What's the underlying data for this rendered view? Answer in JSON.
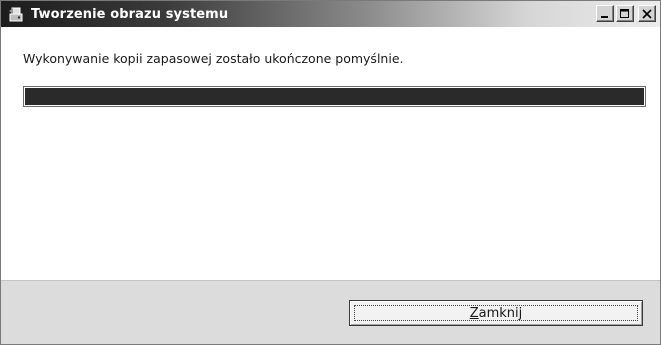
{
  "window": {
    "title": "Tworzenie obrazu systemu",
    "icon": "backup-app-icon"
  },
  "caption_buttons": {
    "minimize_icon": "minimize-icon",
    "maximize_icon": "maximize-icon",
    "close_icon": "close-icon"
  },
  "content": {
    "message": "Wykonywanie kopii zapasowej zostało ukończone pomyślnie.",
    "progress_percent": 100
  },
  "footer": {
    "close_button_mnemonic": "Z",
    "close_button_rest": "amknij"
  }
}
